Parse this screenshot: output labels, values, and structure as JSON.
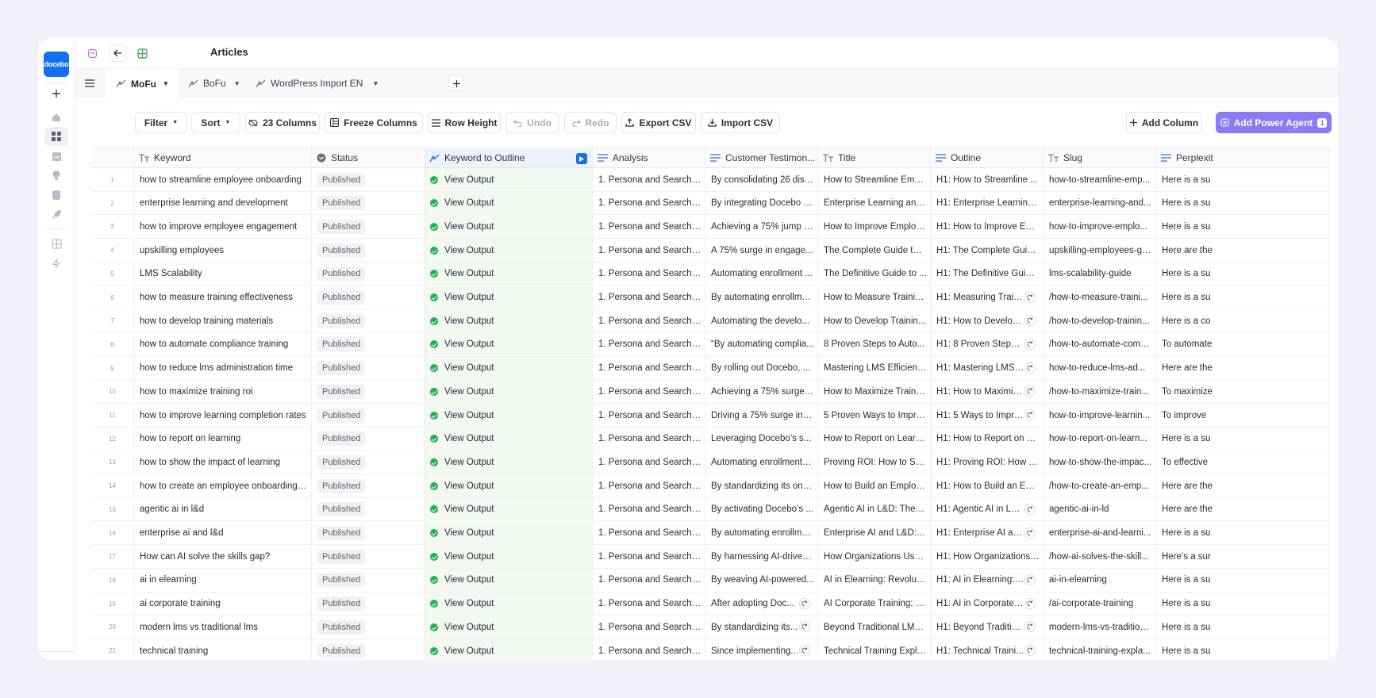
{
  "sidebar": {
    "logo_text": "docebo"
  },
  "topbar": {
    "title": "Articles"
  },
  "tabs": [
    {
      "label": "MoFu",
      "active": true
    },
    {
      "label": "BoFu",
      "active": false
    },
    {
      "label": "WordPress Import EN",
      "active": false
    }
  ],
  "toolbar": {
    "filter": "Filter",
    "sort": "Sort",
    "columns": "23 Columns",
    "freeze": "Freeze Columns",
    "row_height": "Row Height",
    "undo": "Undo",
    "redo": "Redo",
    "export": "Export CSV",
    "import": "Import CSV",
    "add_column": "Add Column",
    "add_power_agent": "Add Power Agent",
    "power_agent_count": "1"
  },
  "colors": {
    "accent": "#8b7cf6",
    "logo": "#1570ef",
    "success": "#22b14c"
  },
  "columns": [
    "Keyword",
    "Status",
    "Keyword to Outline",
    "Analysis",
    "Customer Testimon...",
    "Title",
    "Outline",
    "Slug",
    "Perplexit"
  ],
  "rows": [
    {
      "n": "1",
      "keyword": "how to streamline employee onboarding",
      "status": "Published",
      "output": "View Output",
      "analysis": "1. Persona and Search In...",
      "testimonial": "By consolidating 26 disp...",
      "title": "How to Streamline Empl...",
      "outline": "H1: How to Streamline ...",
      "slug": "how-to-streamline-emp...",
      "perplexity": "Here is a su",
      "r_test": false,
      "r_outline": false
    },
    {
      "n": "2",
      "keyword": "enterprise learning and development",
      "status": "Published",
      "output": "View Output",
      "analysis": "1. Persona and Search In...",
      "testimonial": "By integrating Docebo w...",
      "title": "Enterprise Learning and...",
      "outline": "H1: Enterprise Learning ...",
      "slug": "enterprise-learning-and...",
      "perplexity": "Here is a su",
      "r_test": false,
      "r_outline": false
    },
    {
      "n": "3",
      "keyword": "how to improve employee engagement",
      "status": "Published",
      "output": "View Output",
      "analysis": "1. Persona and Search In...",
      "testimonial": "Achieving a 75% jump in...",
      "title": "How to Improve Employ...",
      "outline": "H1: How to Improve Emp...",
      "slug": "how-to-improve-emplo...",
      "perplexity": "Here is a su",
      "r_test": false,
      "r_outline": false
    },
    {
      "n": "4",
      "keyword": "upskilling employees",
      "status": "Published",
      "output": "View Output",
      "analysis": "1. Persona and Search In...",
      "testimonial": "A 75% surge in engage...",
      "title": "The Complete Guide to ...",
      "outline": "H1: The Complete Guide...",
      "slug": "upskilling-employees-gu...",
      "perplexity": "Here are the",
      "r_test": false,
      "r_outline": false
    },
    {
      "n": "5",
      "keyword": "LMS Scalability",
      "status": "Published",
      "output": "View Output",
      "analysis": "1. Persona and Search In...",
      "testimonial": "Automating enrollment ...",
      "title": "The Definitive Guide to ...",
      "outline": "H1: The Definitive Guide ...",
      "slug": "lms-scalability-guide",
      "perplexity": "Here is a su",
      "r_test": false,
      "r_outline": false
    },
    {
      "n": "6",
      "keyword": "how to measure training effectiveness",
      "status": "Published",
      "output": "View Output",
      "analysis": "1. Persona and Search In...",
      "testimonial": "By automating enrollmen...",
      "title": "How to Measure Trainin...",
      "outline": "H1: Measuring Train...",
      "slug": "/how-to-measure-traini...",
      "perplexity": "Here is a su",
      "r_test": false,
      "r_outline": true
    },
    {
      "n": "7",
      "keyword": "how to develop training materials",
      "status": "Published",
      "output": "View Output",
      "analysis": "1. Persona and Search In...",
      "testimonial": "Automating the develo...",
      "title": "How to Develop Trainin...",
      "outline": "H1: How to Develop ...",
      "slug": "/how-to-develop-trainin...",
      "perplexity": "Here is a co",
      "r_test": false,
      "r_outline": true
    },
    {
      "n": "8",
      "keyword": "how to automate compliance training",
      "status": "Published",
      "output": "View Output",
      "analysis": "1. Persona and Search In...",
      "testimonial": "“By automating complia...",
      "title": "8 Proven Steps to Auto...",
      "outline": "H1: 8 Proven Steps t...",
      "slug": "/how-to-automate-comp...",
      "perplexity": "To automate",
      "r_test": false,
      "r_outline": true
    },
    {
      "n": "9",
      "keyword": "how to reduce lms administration time",
      "status": "Published",
      "output": "View Output",
      "analysis": "1. Persona and Search In...",
      "testimonial": "By rolling out Docebo, ...",
      "title": "Mastering LMS Efficienc...",
      "outline": "H1: Mastering LMS E...",
      "slug": "how-to-reduce-lms-ad...",
      "perplexity": "Here are the",
      "r_test": false,
      "r_outline": true
    },
    {
      "n": "10",
      "keyword": "how to maximize training roi",
      "status": "Published",
      "output": "View Output",
      "analysis": "1. Persona and Search In...",
      "testimonial": "Achieving a 75% surge i...",
      "title": "How to Maximize Trainin...",
      "outline": "H1: How to Maximiz...",
      "slug": "/how-to-maximize-train...",
      "perplexity": "To maximize",
      "r_test": false,
      "r_outline": true
    },
    {
      "n": "11",
      "keyword": "how to improve learning completion rates",
      "status": "Published",
      "output": "View Output",
      "analysis": "1. Persona and Search In...",
      "testimonial": "Driving a 75% surge in t...",
      "title": "5 Proven Ways to Impro...",
      "outline": "H1: 5 Ways to Impro...",
      "slug": "how-to-improve-learnin...",
      "perplexity": "To improve",
      "r_test": false,
      "r_outline": true
    },
    {
      "n": "12",
      "keyword": "how to report on learning",
      "status": "Published",
      "output": "View Output",
      "analysis": "1. Persona and Search In...",
      "testimonial": "Leveraging Docebo’s s...",
      "title": "How to Report on Learn...",
      "outline": "H1: How to Report on Le...",
      "slug": "how-to-report-on-learn...",
      "perplexity": "Here is a su",
      "r_test": false,
      "r_outline": false
    },
    {
      "n": "13",
      "keyword": "how to show the impact of learning",
      "status": "Published",
      "output": "View Output",
      "analysis": "1. Persona and Search In...",
      "testimonial": "Automating enrollments...",
      "title": "Proving ROI: How to Sh...",
      "outline": "H1: Proving ROI: How to...",
      "slug": "how-to-show-the-impac...",
      "perplexity": "To effective",
      "r_test": false,
      "r_outline": false
    },
    {
      "n": "14",
      "keyword": "how to create an employee onboarding p...",
      "status": "Published",
      "output": "View Output",
      "analysis": "1. Persona and Search In...",
      "testimonial": "By standardizing its onb...",
      "title": "How to Build an Employ...",
      "outline": "H1: How to Build an Emp...",
      "slug": "/how-to-create-an-emp...",
      "perplexity": "Here are the",
      "r_test": false,
      "r_outline": false
    },
    {
      "n": "15",
      "keyword": "agentic ai in l&d",
      "status": "Published",
      "output": "View Output",
      "analysis": "1. Persona and Search In...",
      "testimonial": "By activating Docebo’s ...",
      "title": "Agentic AI in L&D: The D...",
      "outline": "H1: Agentic AI in L&D...",
      "slug": "agentic-ai-in-ld",
      "perplexity": "Here are the",
      "r_test": false,
      "r_outline": true
    },
    {
      "n": "16",
      "keyword": "enterprise ai and l&d",
      "status": "Published",
      "output": "View Output",
      "analysis": "1. Persona and Search In...",
      "testimonial": "By automating enrollmen...",
      "title": "Enterprise AI and L&D: 5...",
      "outline": "H1: Enterprise AI an...",
      "slug": "enterprise-ai-and-learni...",
      "perplexity": "Here is a su",
      "r_test": false,
      "r_outline": true
    },
    {
      "n": "17",
      "keyword": "How can AI solve the skills gap?",
      "status": "Published",
      "output": "View Output",
      "analysis": "1. Persona and Search In...",
      "testimonial": "By harnessing AI-driven...",
      "title": "How Organizations Use ...",
      "outline": "H1: How Organizations ...",
      "slug": "/how-ai-solves-the-skill...",
      "perplexity": "Here’s a sur",
      "r_test": false,
      "r_outline": false
    },
    {
      "n": "18",
      "keyword": "ai in elearning",
      "status": "Published",
      "output": "View Output",
      "analysis": "1. Persona and Search In...",
      "testimonial": "By weaving AI-powered...",
      "title": "AI in Elearning: Revolutio...",
      "outline": "H1: AI in Elearning: ...",
      "slug": "ai-in-elearning",
      "perplexity": "Here is a su",
      "r_test": false,
      "r_outline": true
    },
    {
      "n": "19",
      "keyword": "ai corporate training",
      "status": "Published",
      "output": "View Output",
      "analysis": "1. Persona and Search In...",
      "testimonial": "After adopting Doc...",
      "title": "AI Corporate Training: Bu...",
      "outline": "H1: AI in Corporate ...",
      "slug": "/ai-corporate-training",
      "perplexity": "Here is a su",
      "r_test": true,
      "r_outline": true
    },
    {
      "n": "20",
      "keyword": "modern lms vs traditional lms",
      "status": "Published",
      "output": "View Output",
      "analysis": "1. Persona and Search In...",
      "testimonial": "By standardizing its...",
      "title": "Beyond Traditional LMS:...",
      "outline": "H1: Beyond Tradition...",
      "slug": "modern-lms-vs-tradition...",
      "perplexity": "Here is a su",
      "r_test": true,
      "r_outline": true
    },
    {
      "n": "21",
      "keyword": "technical training",
      "status": "Published",
      "output": "View Output",
      "analysis": "1. Persona and Search In...",
      "testimonial": "Since implementing...",
      "title": "Technical Training Expla...",
      "outline": "H1: Technical Traini...",
      "slug": "technical-training-expla...",
      "perplexity": "Here is a su",
      "r_test": true,
      "r_outline": true
    }
  ]
}
